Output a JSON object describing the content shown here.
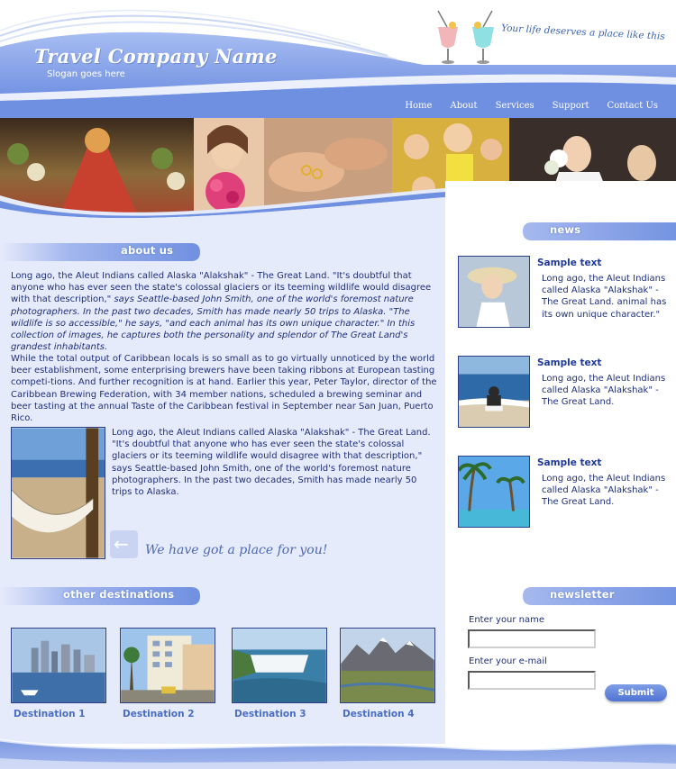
{
  "header": {
    "brand_title": "Travel Company Name",
    "brand_slogan": "Slogan goes here",
    "tagline": "Your life deserves a place like this"
  },
  "nav": [
    "Home",
    "About",
    "Services",
    "Support",
    "Contact Us"
  ],
  "about": {
    "heading": "about us",
    "para1_a": "Long ago, the Aleut Indians called Alaska \"Alakshak\" - The Great Land. \"It's doubtful that anyone who has ever seen the state's colossal glaciers or its teeming wildlife would disagree with that description,\"",
    "para1_b": " says Seattle-based John Smith, one of the world's foremost nature photographers. In the past two decades, Smith has made nearly 50 trips to Alaska. \"The wildlife is so accessible,\" he says, \"and each animal has its own unique character.\" In this collection of images, he captures both the personality and splendor of The Great Land's grandest inhabitants.",
    "para2": "While the total output of Caribbean locals is so small as to go virtually unnoticed by the world beer establishment, some enterprising brewers have been taking ribbons at European tasting competi-tions. And further recognition is at hand. Earlier this year, Peter Taylor, director of the Caribbean Brewing Federation, with 34 member nations, scheduled a brewing seminar and beer tasting at the annual Taste of the Caribbean festival in September near San Juan, Puerto Rico.",
    "para3": "Long ago, the Aleut Indians called Alaska \"Alakshak\" - The Great Land. \"It's doubtful that anyone who has ever seen the state's colossal glaciers or its teeming wildlife would disagree with that description,\" says Seattle-based John Smith, one of the world's foremost nature photographers. In the past two decades, Smith has made nearly 50 trips to Alaska.",
    "place_slogan": "We have got a place for you!"
  },
  "destinations": {
    "heading": "other destinations",
    "items": [
      "Destination 1",
      "Destination 2",
      "Destination 3",
      "Destination 4"
    ]
  },
  "news": {
    "heading": "news",
    "items": [
      {
        "title": "Sample text",
        "body": "Long ago, the Aleut Indians called Alaska \"Alakshak\" - The Great Land.  animal has its own unique character.\""
      },
      {
        "title": "Sample text",
        "body": "Long ago, the Aleut Indians called Alaska \"Alakshak\" - The Great Land."
      },
      {
        "title": "Sample text",
        "body": "Long ago, the Aleut Indians called Alaska \"Alakshak\" - The Great Land."
      }
    ]
  },
  "newsletter": {
    "heading": "newsletter",
    "name_label": "Enter your name",
    "email_label": "Enter your e-mail",
    "name_value": "",
    "email_value": "",
    "submit_label": "Submit"
  },
  "colors": {
    "brand_blue": "#6f8fe0",
    "light_panel": "#e6ebfb",
    "text_navy": "#1f2f7a",
    "link_blue": "#4a6cc4"
  }
}
